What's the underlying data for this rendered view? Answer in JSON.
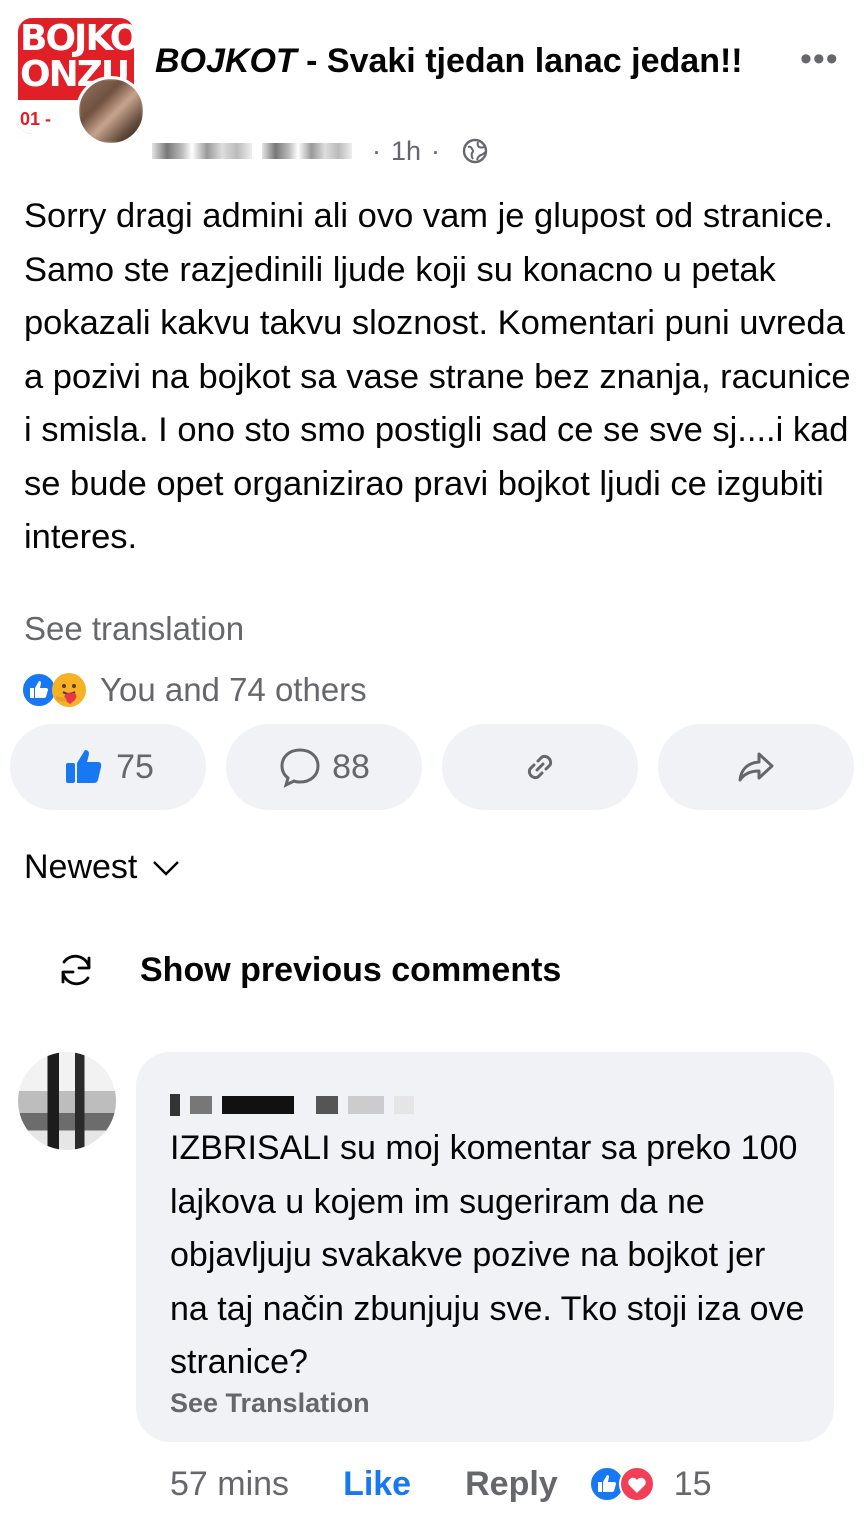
{
  "header": {
    "logo_lines": [
      "BOJKOT",
      "ONZU",
      "01 -"
    ],
    "group_name": "BOJKOT",
    "title_rest": " - Svaki tjedan lanac jedan!!",
    "time": "1h",
    "separator": "·",
    "more": "•••"
  },
  "post": {
    "text": "Sorry dragi admini ali ovo vam je glupost od stranice. Samo ste razjedinili ljude koji su konacno u petak pokazali kakvu takvu sloznost. Komentari puni uvreda a pozivi na bojkot sa vase strane bez znanja, racunice i smisla. I ono sto smo postigli sad ce se sve sj....i kad se bude opet organizirao pravi bojkot ljudi ce izgubiti interes.",
    "see_translation": "See translation",
    "reactions_text": "You and 74 others",
    "reaction_icons": [
      "like-icon",
      "care-icon"
    ]
  },
  "actions": {
    "like_count": "75",
    "comment_count": "88"
  },
  "comments_section": {
    "sort_label": "Newest",
    "show_previous": "Show previous comments"
  },
  "comment": {
    "text": "IZBRISALI su moj komentar sa preko 100 lajkova u kojem im sugeriram da ne objavljuju svakakve pozive na bojkot jer na taj način zbunjuju sve. Tko stoji iza ove stranice?",
    "see_translation": "See Translation",
    "time": "57 mins",
    "like_label": "Like",
    "reply_label": "Reply",
    "reaction_count": "15",
    "reaction_icons": [
      "like-icon",
      "love-icon"
    ]
  },
  "colors": {
    "accent": "#1877f2",
    "secondary_text": "#65676b",
    "button_bg": "#f0f2f5",
    "logo_red": "#e01f26"
  }
}
